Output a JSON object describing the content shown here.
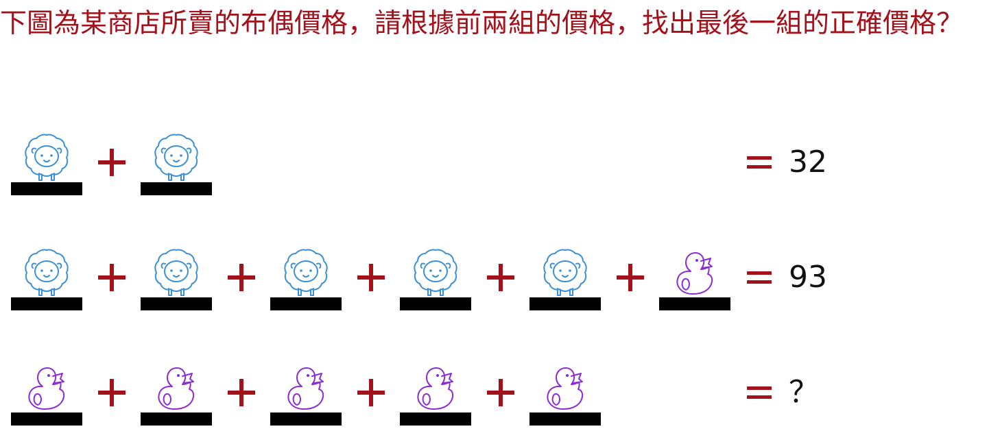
{
  "question": "下圖為某商店所賣的布偶價格，請根據前兩組的價格，找出最後一組的正確價格？",
  "colors": {
    "question_text": "#a3111a",
    "operator": "#a3111a",
    "sheep_outline": "#3b8fd6",
    "duck_outline": "#8a2bd6",
    "bar": "#000000",
    "answer_text": "#111111"
  },
  "equations": [
    {
      "items": [
        "sheep",
        "sheep"
      ],
      "operator": "plus",
      "result": "32"
    },
    {
      "items": [
        "sheep",
        "sheep",
        "sheep",
        "sheep",
        "sheep",
        "duck"
      ],
      "operator": "plus",
      "result": "93"
    },
    {
      "items": [
        "duck",
        "duck",
        "duck",
        "duck",
        "duck"
      ],
      "operator": "plus",
      "result": "？"
    }
  ],
  "icons": {
    "sheep": "sheep-icon",
    "duck": "rubber-duck-icon",
    "plus": "plus-sign-icon",
    "equals": "equals-sign-icon"
  }
}
